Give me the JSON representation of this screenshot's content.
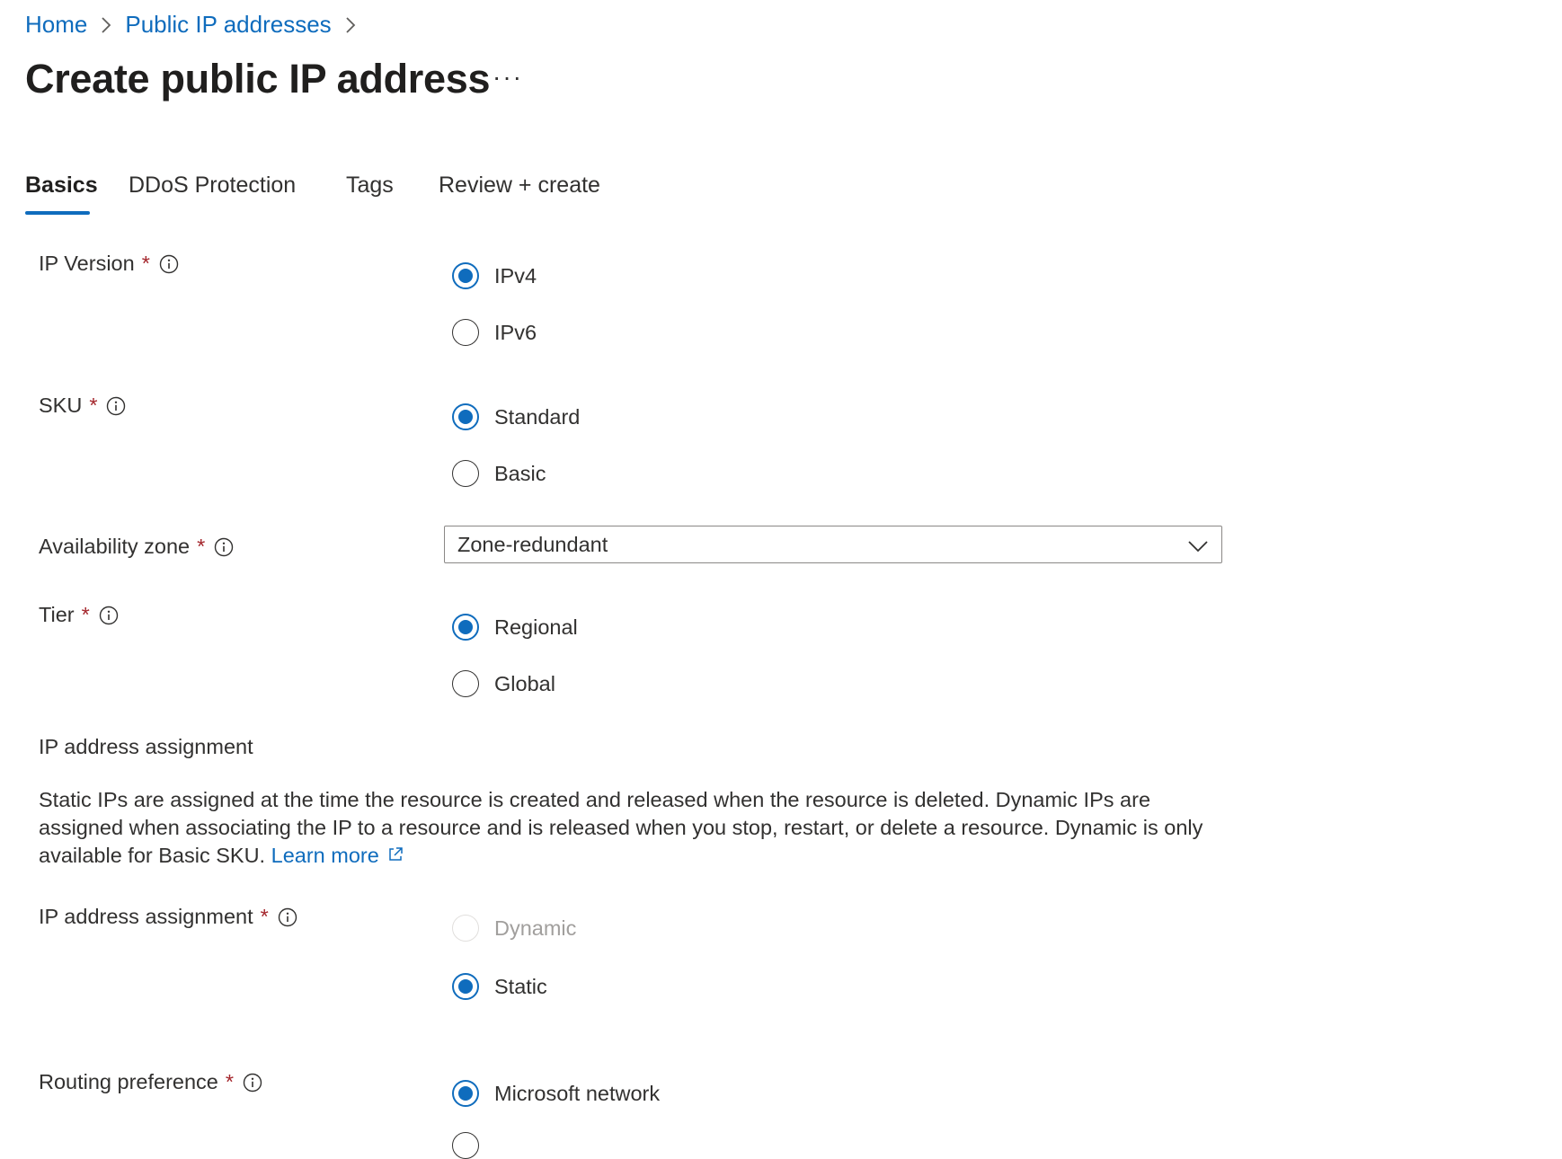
{
  "breadcrumb": {
    "home": "Home",
    "parent": "Public IP addresses"
  },
  "page": {
    "title": "Create public IP address",
    "more": "···"
  },
  "tabs": [
    {
      "label": "Basics",
      "active": true
    },
    {
      "label": "DDoS Protection"
    },
    {
      "label": "Tags"
    },
    {
      "label": "Review + create"
    }
  ],
  "form": {
    "required_mark": "*",
    "ip_version": {
      "label": "IP Version",
      "options": [
        "IPv4",
        "IPv6"
      ],
      "selected": "IPv4"
    },
    "sku": {
      "label": "SKU",
      "options": [
        "Standard",
        "Basic"
      ],
      "selected": "Standard"
    },
    "availability_zone": {
      "label": "Availability zone",
      "value": "Zone-redundant"
    },
    "tier": {
      "label": "Tier",
      "options": [
        "Regional",
        "Global"
      ],
      "selected": "Regional"
    },
    "ip_assignment_section": {
      "heading": "IP address assignment",
      "description": "Static IPs are assigned at the time the resource is created and released when the resource is deleted. Dynamic IPs are assigned when associating the IP to a resource and is released when you stop, restart, or delete a resource. Dynamic is only available for Basic SKU.",
      "learn_more": "Learn more"
    },
    "ip_assignment": {
      "label": "IP address assignment",
      "options": [
        "Dynamic",
        "Static"
      ],
      "selected": "Static",
      "disabled": [
        "Dynamic"
      ]
    },
    "routing_preference": {
      "label": "Routing preference",
      "options": [
        "Microsoft network"
      ],
      "selected": "Microsoft network"
    }
  },
  "colors": {
    "accent": "#0f6cbd",
    "required": "#a4262c",
    "text": "#323130",
    "disabled": "#a19f9d"
  },
  "icons": {
    "info": "info-icon",
    "chevron": "chevron-down-icon",
    "breadcrumb_sep": "chevron-right-icon",
    "external": "external-link-icon"
  }
}
